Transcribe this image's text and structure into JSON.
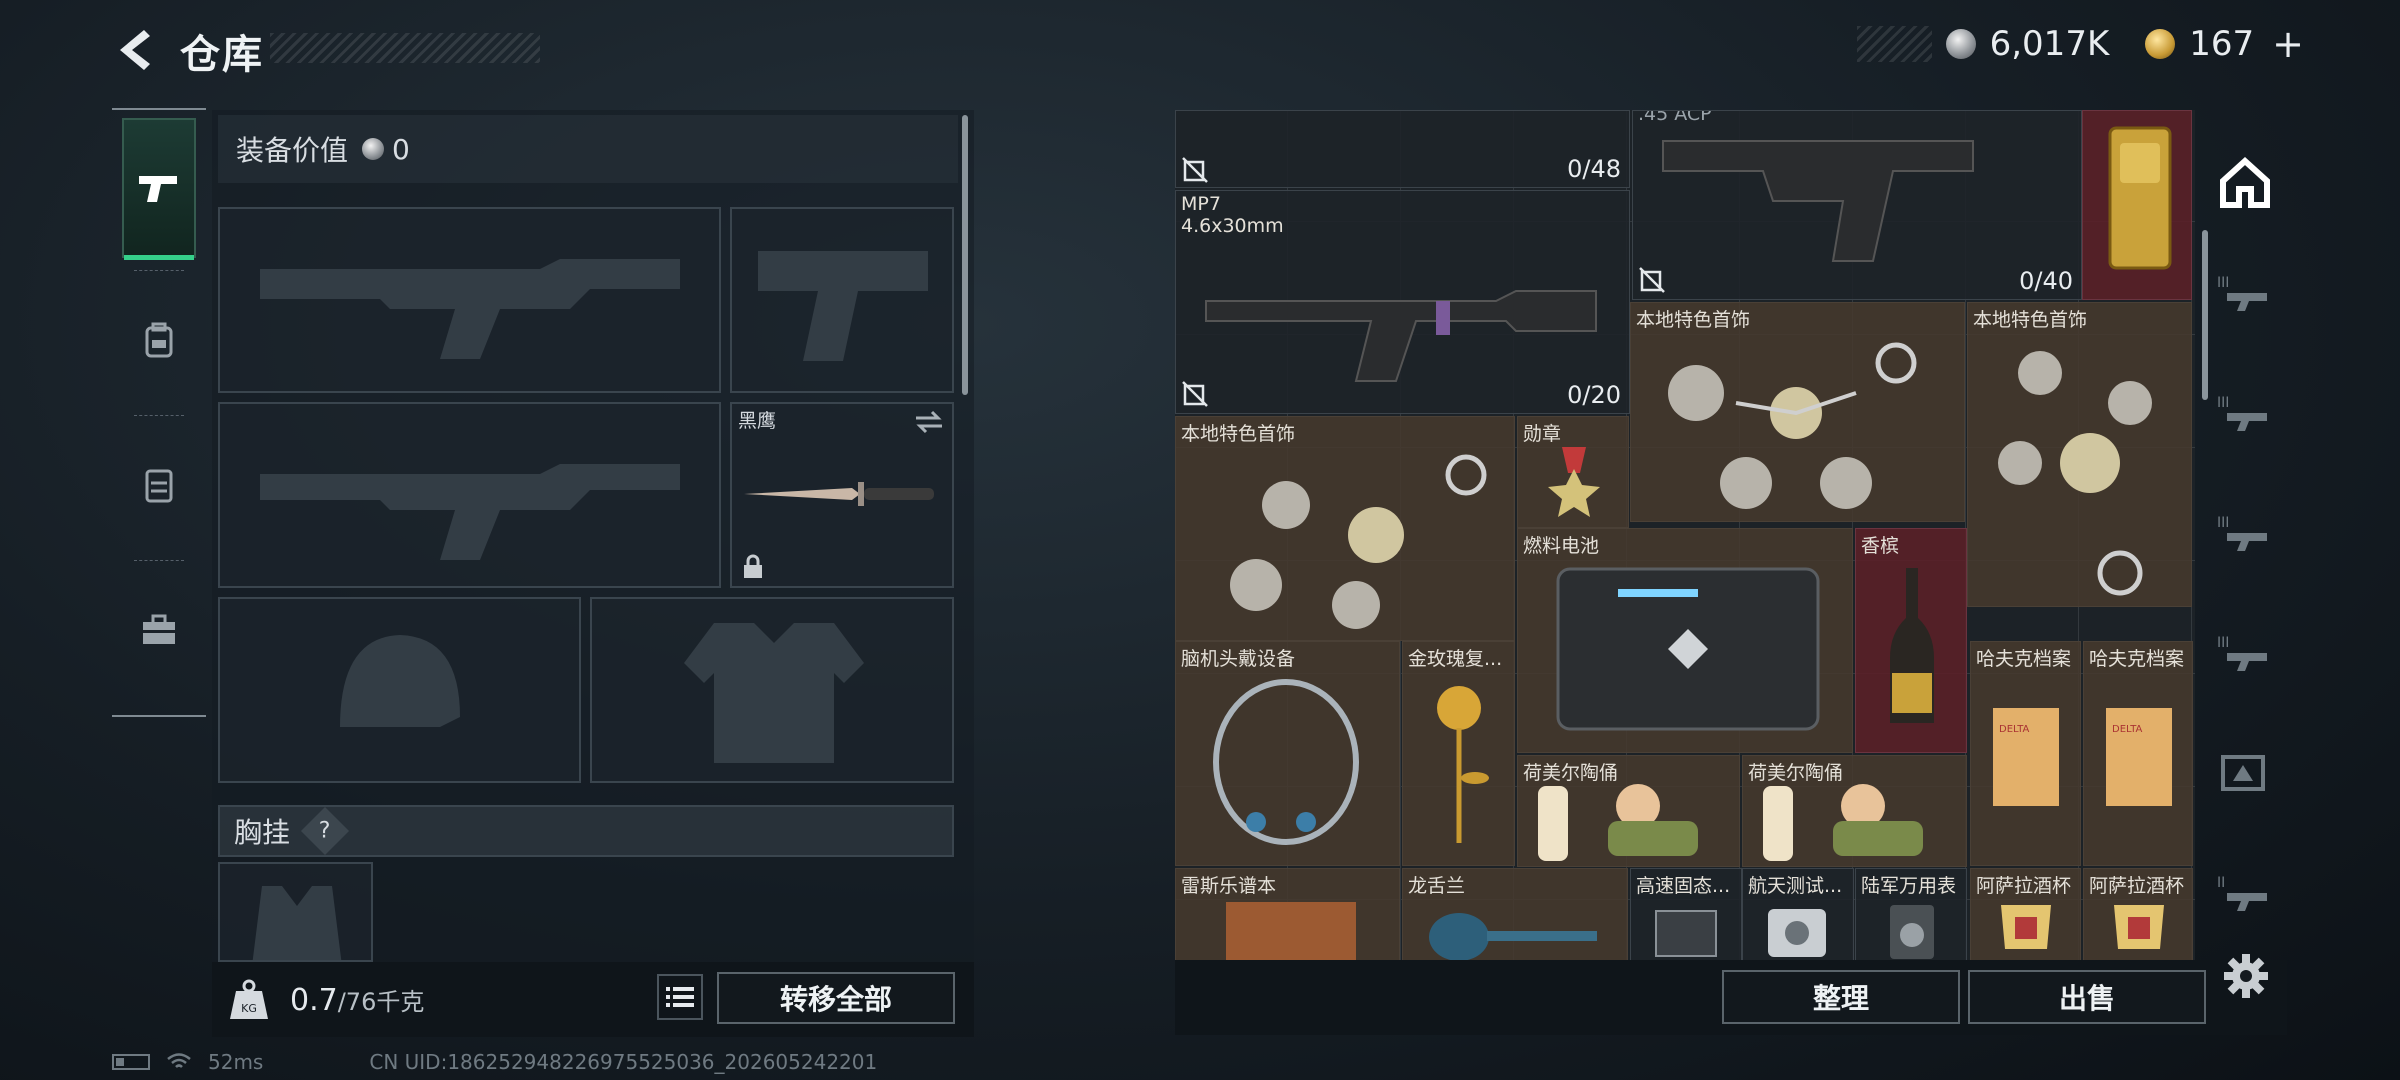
{
  "header": {
    "title": "仓库",
    "back_icon": "chevron-left-icon"
  },
  "currency": {
    "silver_amount": "6,017K",
    "gold_amount": "167",
    "plus": "+"
  },
  "categories": [
    {
      "name": "weapons",
      "icon": "pistol-icon",
      "active": true
    },
    {
      "name": "backpack",
      "icon": "backpack-icon",
      "active": false
    },
    {
      "name": "armor-vest",
      "icon": "vest-icon",
      "active": false
    },
    {
      "name": "toolbox",
      "icon": "toolbox-icon",
      "active": false
    }
  ],
  "equipment": {
    "value_label": "装备价值",
    "value": "0",
    "melee_label": "黑鹰",
    "chest_label": "胸挂",
    "chest_help": "?"
  },
  "weight": {
    "current": "0.7",
    "max": "/76千克",
    "kg_badge": "KG",
    "transfer_label": "转移全部"
  },
  "footer": {
    "ping": "52ms",
    "uid": "CN UID:1862529482269755250​36_202605242201"
  },
  "stash": {
    "sort_label": "整理",
    "sell_label": "出售",
    "items": {
      "top_left_count": "0/48",
      "mp7_name": "MP7",
      "mp7_ammo": "4.6x30mm",
      "mp7_count": "0/20",
      "acp_name": ".45 ACP",
      "acp_count": "0/40",
      "jewel1": "本地特色首饰",
      "jewel2": "本地特色首饰",
      "jewel3": "本地特色首饰",
      "medal": "勋章",
      "fuel": "燃料电池",
      "champagne": "香槟",
      "headset": "脑机头戴设备",
      "rose": "金玫瑰复...",
      "harv1": "哈夫克档案",
      "harv2": "哈夫克档案",
      "figurine1": "荷美尔陶俑",
      "figurine2": "荷美尔陶俑",
      "book": "雷斯乐谱本",
      "dragon": "龙舌兰",
      "ssd": "高速固态...",
      "space": "航天测试...",
      "watch": "陆军万用表",
      "cup1": "阿萨拉酒杯",
      "cup2": "阿萨拉酒杯"
    }
  }
}
